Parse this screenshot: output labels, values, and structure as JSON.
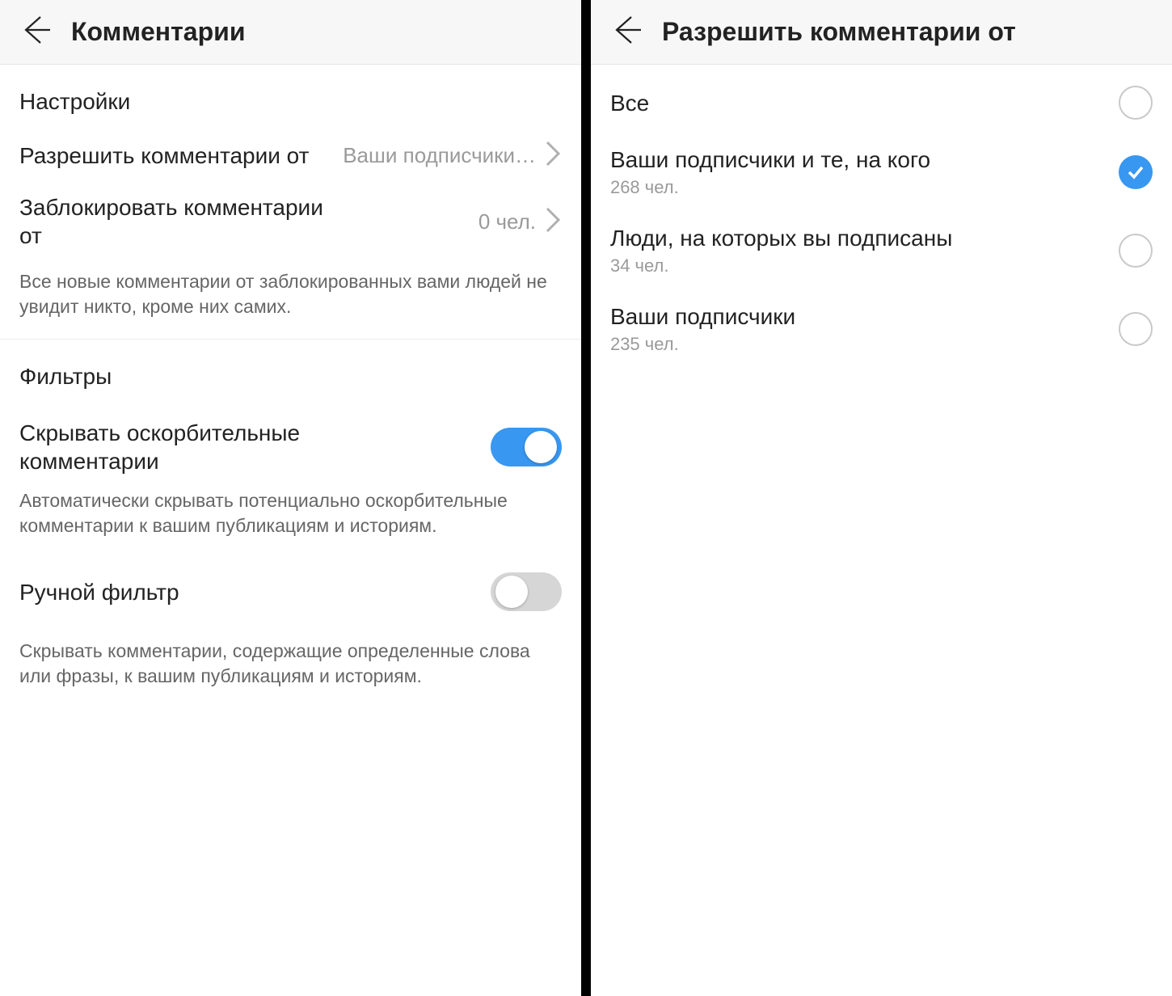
{
  "left": {
    "header_title": "Комментарии",
    "sections": {
      "settings": {
        "title": "Настройки",
        "allow_from": {
          "label": "Разрешить комментарии от",
          "value": "Ваши подписчики…"
        },
        "block_from": {
          "label": "Заблокировать комментарии от",
          "value": "0 чел."
        },
        "block_desc": "Все новые комментарии от заблокированных вами людей не увидит никто, кроме них самих."
      },
      "filters": {
        "title": "Фильтры",
        "hide_offensive": {
          "label": "Скрывать оскорбительные комментарии",
          "on": true,
          "desc": "Автоматически скрывать потенциально оскорбительные комментарии к вашим публикациям и историям."
        },
        "manual_filter": {
          "label": "Ручной фильтр",
          "on": false,
          "desc": "Скрывать комментарии, содержащие определенные слова или фразы, к вашим публикациям и историям."
        }
      }
    }
  },
  "right": {
    "header_title": "Разрешить комментарии от",
    "options": [
      {
        "title": "Все",
        "subtitle": "",
        "selected": false
      },
      {
        "title": "Ваши подписчики и те, на кого",
        "subtitle": "268 чел.",
        "selected": true
      },
      {
        "title": "Люди, на которых вы подписаны",
        "subtitle": "34 чел.",
        "selected": false
      },
      {
        "title": "Ваши подписчики",
        "subtitle": "235 чел.",
        "selected": false
      }
    ]
  }
}
